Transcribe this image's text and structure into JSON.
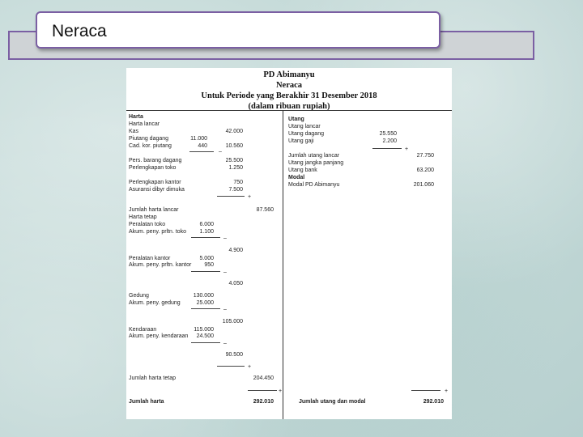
{
  "slide": {
    "title": "Neraca"
  },
  "doc": {
    "company": "PD Abimanyu",
    "report": "Neraca",
    "period": "Untuk Periode yang Berakhir 31 Desember 2018",
    "unit": "(dalam ribuan rupiah)"
  },
  "assets": {
    "heading": "Harta",
    "current_heading": "Harta lancar",
    "kas": {
      "label": "Kas",
      "value": "42.000"
    },
    "piutang": {
      "label": "Piutang dagang",
      "value": "11.000"
    },
    "cadkor": {
      "label": "Cad. kor. piutang",
      "value": "440"
    },
    "piutang_net": "10.560",
    "persediaan": {
      "label": "Pers. barang dagang",
      "value": "25.500"
    },
    "perl_toko": {
      "label": "Perlengkapan toko",
      "value": "1.250"
    },
    "perl_kantor": {
      "label": "Perlengkapan kantor",
      "value": "750"
    },
    "asuransi": {
      "label": "Asuransi dibyr dimuka",
      "value": "7.500"
    },
    "total_current": {
      "label": "Jumlah harta lancar",
      "value": "87.560"
    },
    "fixed_heading": "Harta tetap",
    "per_toko": {
      "label": "Peralatan toko",
      "value": "6.000"
    },
    "akum_toko": {
      "label": "Akum. peny. prltn. toko",
      "value": "1.100"
    },
    "per_toko_net": "4.900",
    "per_kantor": {
      "label": "Peralatan kantor",
      "value": "5.000"
    },
    "akum_kantor": {
      "label": "Akum. peny. prltn. kantor",
      "value": "950"
    },
    "per_kantor_net": "4.050",
    "gedung": {
      "label": "Gedung",
      "value": "130.000"
    },
    "akum_gedung": {
      "label": "Akum. peny. gedung",
      "value": "25.000"
    },
    "gedung_net": "105.000",
    "kendaraan": {
      "label": "Kendaraan",
      "value": "115.000"
    },
    "akum_kend": {
      "label": "Akum. peny. kendaraan",
      "value": "24.500"
    },
    "kend_net": "90.500",
    "total_fixed": {
      "label": "Jumlah harta tetap",
      "value": "204.450"
    },
    "total": {
      "label": "Jumlah harta",
      "value": "292.010"
    }
  },
  "liabilities": {
    "heading": "Utang",
    "current_heading": "Utang lancar",
    "utang_dagang": {
      "label": "Utang dagang",
      "value": "25.550"
    },
    "utang_gaji": {
      "label": "Utang gaji",
      "value": "2.200"
    },
    "total_current": {
      "label": "Jumlah utang lancar",
      "value": "27.750"
    },
    "long_heading": "Utang jangka panjang",
    "utang_bank": {
      "label": "Utang bank",
      "value": "63.200"
    },
    "modal_heading": "Modal",
    "modal": {
      "label": "Modal PD Abimanyu",
      "value": "201.060"
    },
    "total": {
      "label": "Jumlah utang dan modal",
      "value": "292.010"
    }
  },
  "ops": {
    "minus": "–",
    "plus": "+"
  }
}
